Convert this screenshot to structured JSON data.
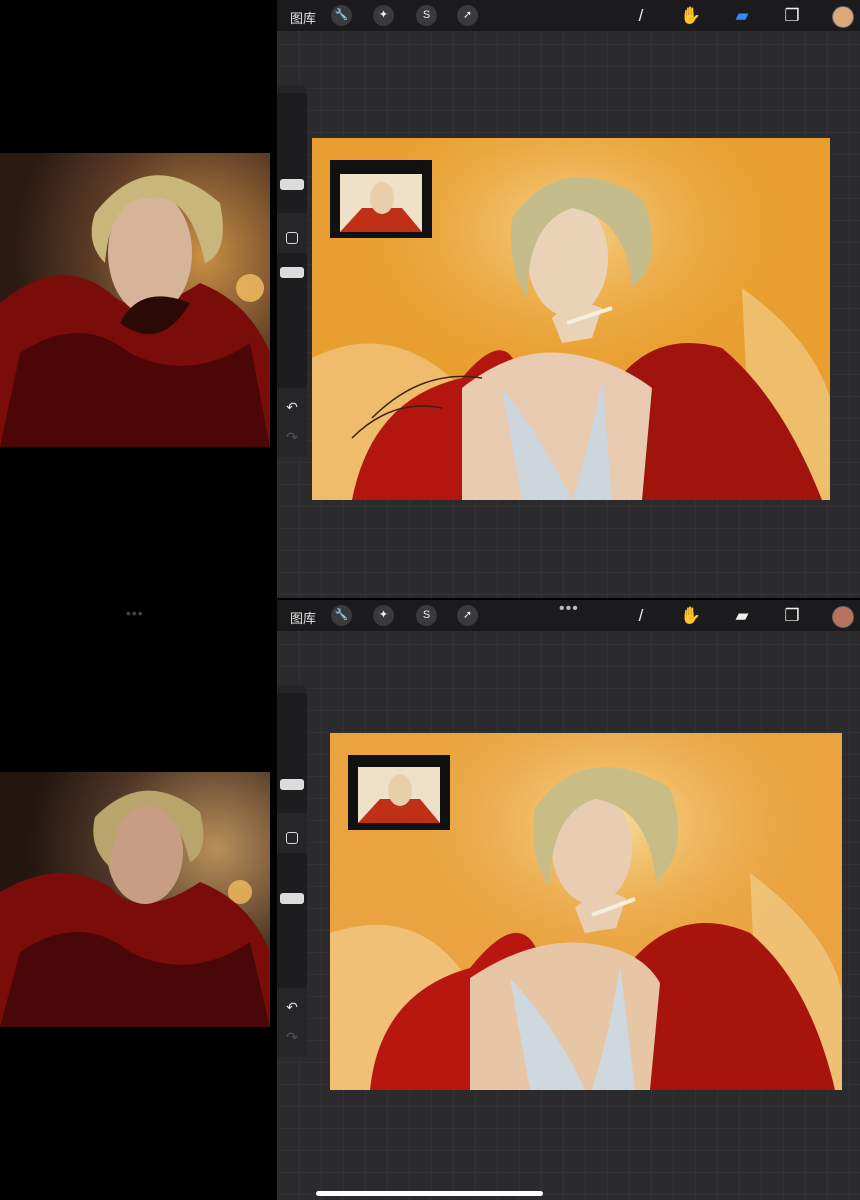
{
  "top_panel": {
    "gallery_label": "图库",
    "tools_left": [
      "wrench-icon",
      "magic-wand-icon",
      "selection-icon",
      "transform-arrow-icon"
    ],
    "tools_right": [
      "brush-icon",
      "smudge-icon",
      "eraser-icon",
      "layers-icon"
    ],
    "active_tool": "eraser",
    "current_color": "#d9a87b"
  },
  "bottom_panel": {
    "gallery_label": "图库",
    "menu_dots": "•••",
    "tools_left": [
      "wrench-icon",
      "magic-wand-icon",
      "selection-icon",
      "transform-arrow-icon"
    ],
    "tools_right": [
      "brush-icon",
      "smudge-icon",
      "eraser-icon",
      "layers-icon"
    ],
    "active_tool": "smudge",
    "current_color": "#b9735d"
  },
  "split_view_handle": "•••",
  "sidebar": {
    "undo_icon": "↶",
    "redo_icon": "↷"
  },
  "colors": {
    "canvas_bg": "#2b2b2d",
    "toolbar_bg": "#1b1b1d",
    "accent_blue": "#2f8cff",
    "painting_orange": "#e9a13a",
    "fur_red": "#b3160f"
  }
}
